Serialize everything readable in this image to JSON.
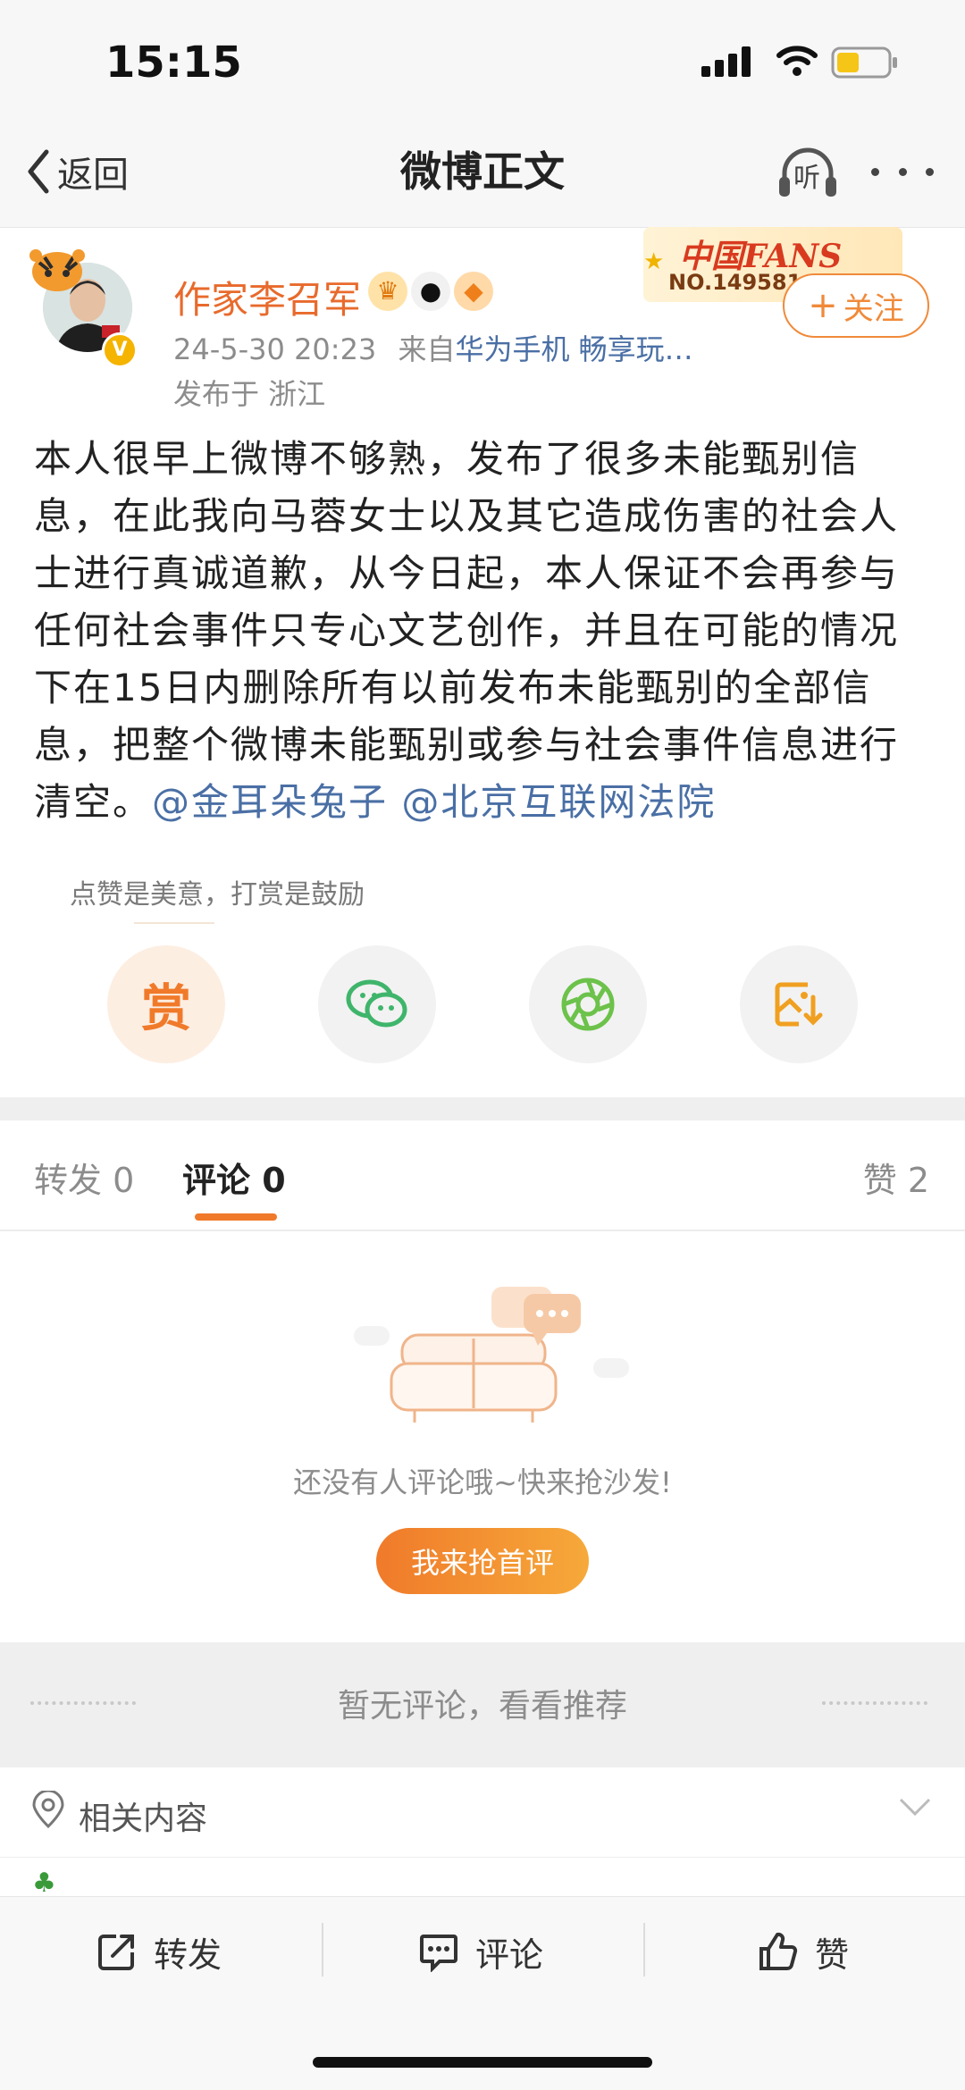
{
  "status_bar": {
    "time": "15:15"
  },
  "nav": {
    "back_label": "返回",
    "title": "微博正文",
    "listen_label": "听"
  },
  "author": {
    "name": "作家李召军",
    "fans_badge_title": "中国FANS",
    "fans_badge_no": "NO.149581",
    "follow_label": "关注",
    "timestamp": "24-5-30 20:23",
    "source_prefix": "来自",
    "source": "华为手机 畅享玩…",
    "location": "发布于 浙江"
  },
  "post": {
    "text": "本人很早上微博不够熟，发布了很多未能甄别信息，在此我向马蓉女士以及其它造成伤害的社会人士进行真诚道歉，从今日起，本人保证不会再参与任何社会事件只专心文艺创作，并且在可能的情况下在15日内删除所有以前发布未能甄别的全部信息，把整个微博未能甄别或参与社会事件信息进行清空。",
    "mention_1": "@金耳朵兔子",
    "mention_2": "@北京互联网法院"
  },
  "reward": {
    "hint": "点赞是美意，打赏是鼓励",
    "reward_label": "赏"
  },
  "tabs": {
    "repost_label": "转发",
    "repost_count": "0",
    "comment_label": "评论",
    "comment_count": "0",
    "like_label": "赞",
    "like_count": "2"
  },
  "empty_state": {
    "text": "还没有人评论哦~快来抢沙发!",
    "button_label": "我来抢首评",
    "no_comment_text": "暂无评论，看看推荐"
  },
  "related": {
    "label": "相关内容"
  },
  "bottom_bar": {
    "repost_label": "转发",
    "comment_label": "评论",
    "like_label": "赞"
  },
  "colors": {
    "accent": "#f07a2a",
    "name": "#e86a2c",
    "link": "#4a6fa5"
  },
  "icons": [
    "back-chevron-icon",
    "listen-headphones-icon",
    "more-icon",
    "verified-icon",
    "wechat-icon",
    "moments-icon",
    "save-image-icon",
    "sofa-icon",
    "location-pin-icon",
    "chevron-down-icon",
    "share-icon",
    "comment-icon",
    "like-icon"
  ]
}
